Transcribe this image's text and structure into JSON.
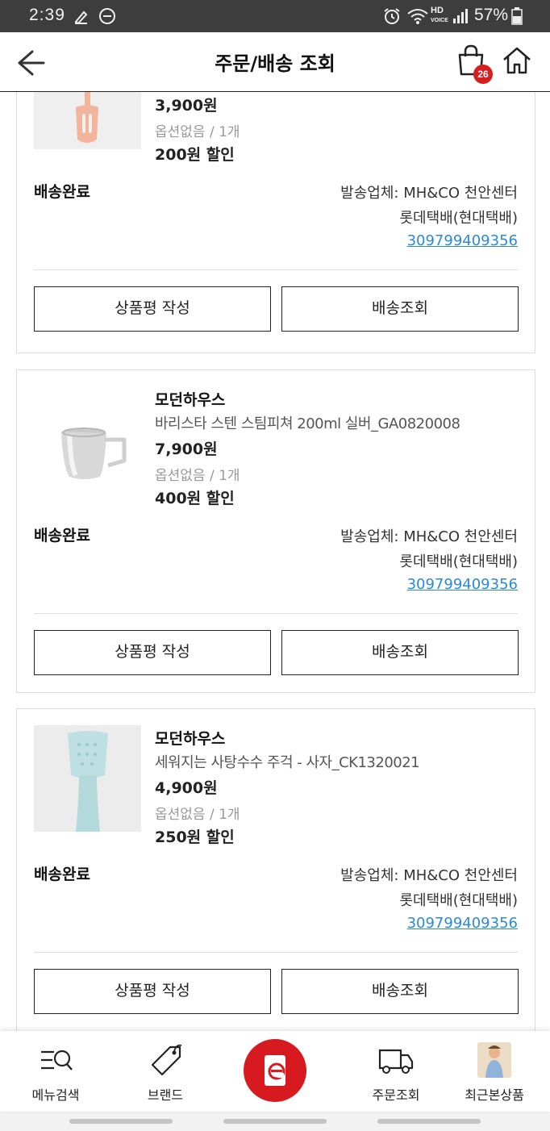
{
  "status_bar": {
    "time": "2:39",
    "battery": "57%"
  },
  "header": {
    "title": "주문/배송 조회",
    "cart_count": "26"
  },
  "orders": [
    {
      "price": "3,900원",
      "option": "옵션없음 / 1개",
      "discount": "200원 할인",
      "status": "배송완료",
      "courier": "발송업체: MH&CO 천안센터",
      "carrier": "롯데택배(현대택배)",
      "tracking": "309799409356",
      "review_label": "상품평 작성",
      "track_label": "배송조회"
    },
    {
      "brand": "모던하우스",
      "name": "바리스타 스텐 스팀피쳐 200ml 실버_GA0820008",
      "price": "7,900원",
      "option": "옵션없음 / 1개",
      "discount": "400원 할인",
      "status": "배송완료",
      "courier": "발송업체: MH&CO 천안센터",
      "carrier": "롯데택배(현대택배)",
      "tracking": "309799409356",
      "review_label": "상품평 작성",
      "track_label": "배송조회"
    },
    {
      "brand": "모던하우스",
      "name": "세워지는 사탕수수 주걱 - 사자_CK1320021",
      "price": "4,900원",
      "option": "옵션없음 / 1개",
      "discount": "250원 할인",
      "status": "배송완료",
      "courier": "발송업체: MH&CO 천안센터",
      "carrier": "롯데택배(현대택배)",
      "tracking": "309799409356",
      "review_label": "상품평 작성",
      "track_label": "배송조회"
    }
  ],
  "bottom_nav": {
    "menu_search": "메뉴검색",
    "brand": "브랜드",
    "order_lookup": "주문조회",
    "recent": "최근본상품"
  },
  "colors": {
    "accent": "#d71920",
    "link": "#2a8ad6"
  }
}
